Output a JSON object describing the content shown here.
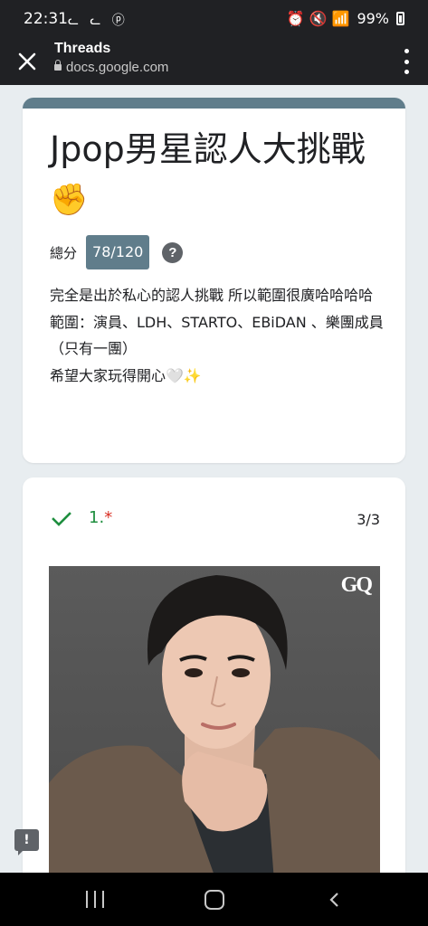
{
  "status_bar": {
    "time": "22:31",
    "left_notifications": "ᓚ ᓚ ⓟ",
    "right_icons": "⏰ 🔇 📶",
    "battery": "99%"
  },
  "app_bar": {
    "title": "Threads",
    "url": "docs.google.com"
  },
  "form": {
    "title": "Jpop男星認人大挑戰",
    "title_emoji": "✊",
    "score_label": "總分",
    "score_value": "78/120",
    "help_icon_glyph": "?",
    "description_lines": [
      "完全是出於私心的認人挑戰 所以範圍很廣哈哈哈哈",
      "範圍：演員、LDH、STARTO、EBiDAN 、樂團成員（只有一團）",
      "希望大家玩得開心🤍✨"
    ],
    "accent_color": "#607d8b"
  },
  "question": {
    "number": "1.",
    "required_mark": "*",
    "score": "3/3",
    "status_color": "#1e8e3e",
    "photo_caption": "GQ"
  },
  "feedback_button_glyph": "!"
}
